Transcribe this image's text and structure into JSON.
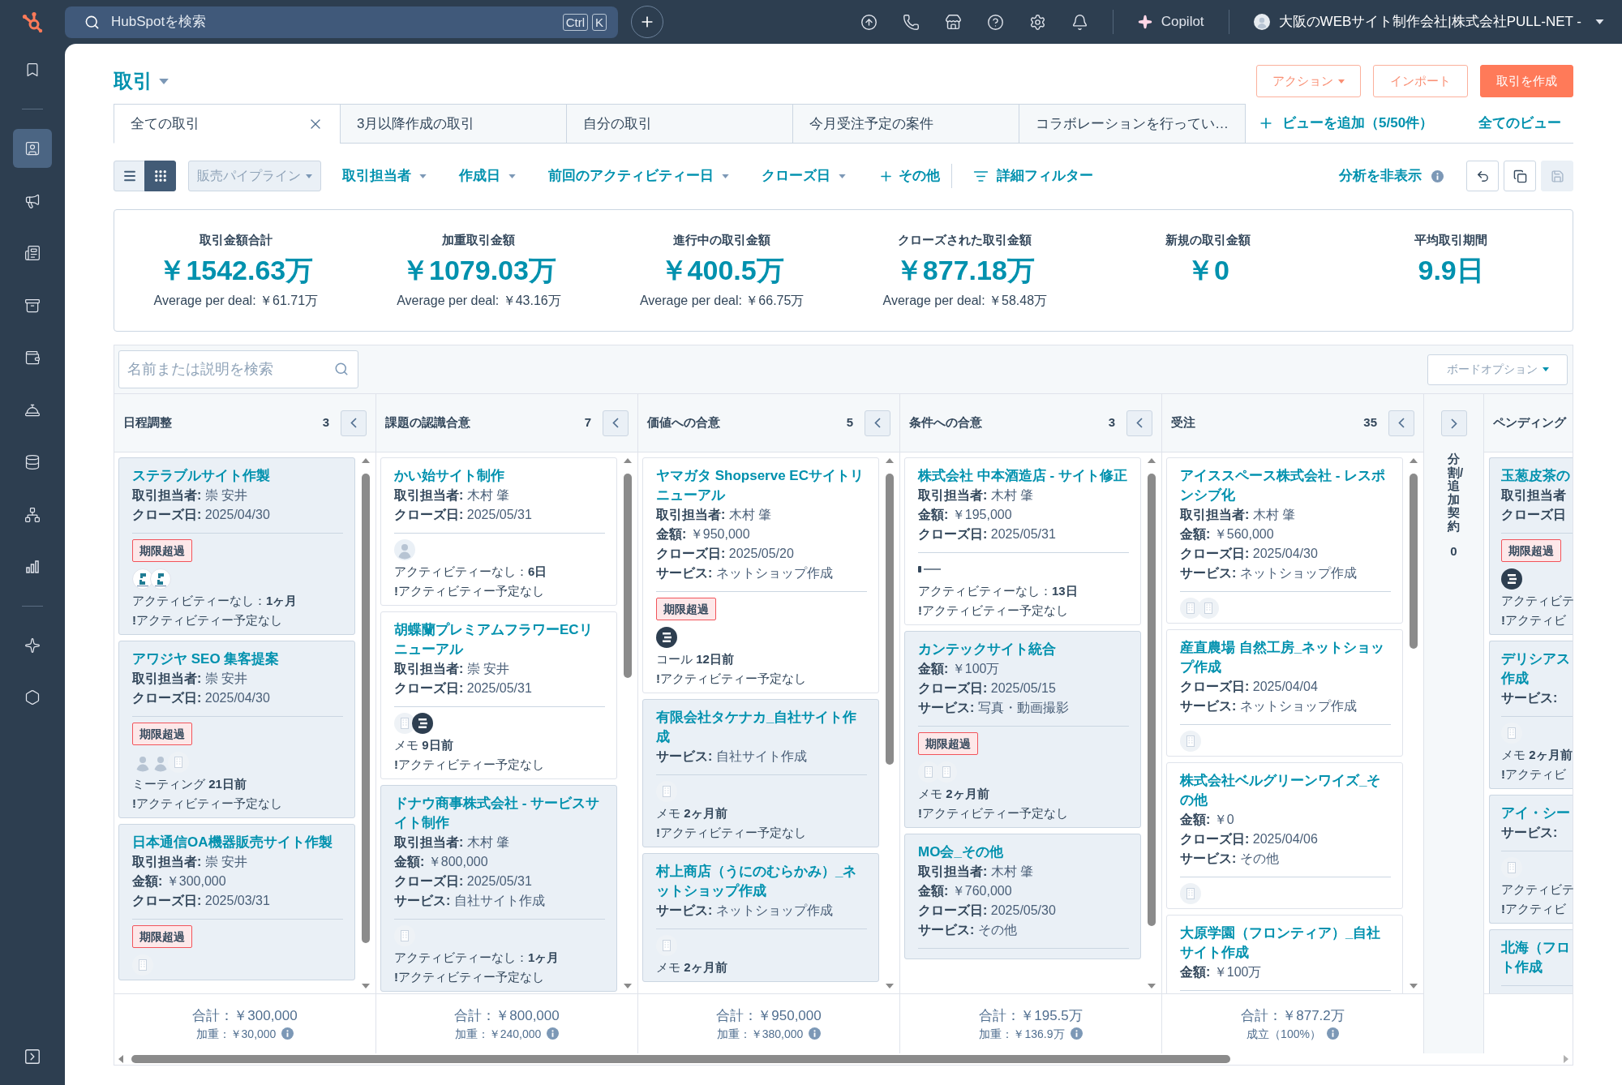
{
  "top_bar": {
    "search": {
      "placeholder": "HubSpotを検索"
    },
    "shortcut_keys": [
      "Ctrl",
      "K"
    ],
    "copilot": "Copilot",
    "account": "大阪のWEBサイト制作会社|株式会社PULL-NET -"
  },
  "sidebar": {
    "items": [
      {
        "selected": false
      },
      {
        "selected": true
      },
      {
        "selected": false
      },
      {
        "selected": false
      },
      {
        "selected": false
      },
      {
        "selected": false
      },
      {
        "selected": false
      },
      {
        "selected": false
      },
      {
        "selected": false
      },
      {
        "selected": false
      },
      {
        "selected": false
      },
      {
        "selected": false
      }
    ]
  },
  "header": {
    "title": "取引",
    "buttons": [
      {
        "label": "アクション",
        "kind": "menu"
      },
      {
        "label": "インポート",
        "kind": "outline"
      },
      {
        "label": "取引を作成",
        "kind": "primary"
      }
    ]
  },
  "view_tabs": {
    "tabs": [
      {
        "label": "全ての取引",
        "selected": true
      },
      {
        "label": "3月以降作成の取引",
        "selected": false
      },
      {
        "label": "自分の取引",
        "selected": false
      },
      {
        "label": "今月受注予定の案件",
        "selected": false
      },
      {
        "label": "コラボレーションを行ってい…",
        "selected": false
      }
    ],
    "add_view": "ビューを追加（5/50件）",
    "all_views": "全てのビュー"
  },
  "filter_bar": {
    "view_modes": [
      {
        "selected": false
      },
      {
        "selected": true
      }
    ],
    "pipeline": "販売パイプライン",
    "filters": [
      {
        "label": "取引担当者",
        "kind": "dropdown"
      },
      {
        "label": "作成日",
        "kind": "dropdown"
      },
      {
        "label": "前回のアクティビティー日",
        "kind": "dropdown"
      },
      {
        "label": "クローズ日",
        "kind": "dropdown"
      },
      {
        "label": "その他",
        "kind": "add"
      }
    ],
    "advanced_filters": "詳細フィルター",
    "analytics_toggle": "分析を非表示",
    "tools": [
      {
        "disabled": false
      },
      {
        "disabled": false
      },
      {
        "disabled": true
      }
    ]
  },
  "metrics": [
    {
      "label": "取引金額合計",
      "value": "￥1542.63万",
      "average": "Average per deal: ￥61.71万"
    },
    {
      "label": "加重取引金額",
      "value": "￥1079.03万",
      "average": "Average per deal: ￥43.16万"
    },
    {
      "label": "進行中の取引金額",
      "value": "￥400.5万",
      "average": "Average per deal: ￥66.75万"
    },
    {
      "label": "クローズされた取引金額",
      "value": "￥877.18万",
      "average": "Average per deal: ￥58.48万"
    },
    {
      "label": "新規の取引金額",
      "value": "￥0"
    },
    {
      "label": "平均取引期間",
      "value": "9.9日"
    }
  ],
  "board": {
    "search": {
      "placeholder": "名前または説明を検索"
    },
    "options": "ボードオプション",
    "columns": [
      {
        "name": "日程調整",
        "count": "3",
        "collapsed": false,
        "cards": [
          {
            "title": "ステラブルサイト作製",
            "shaded": true,
            "fields": [
              {
                "label": "取引担当者:",
                "value": "崇 安井"
              },
              {
                "label": "クローズ日:",
                "value": "2025/04/30"
              }
            ],
            "badge": "期限超過",
            "avatars": [
              {
                "kind": "monogram"
              },
              {
                "kind": "monogram"
              }
            ],
            "activity": "アクティビティーなし：**1ヶ月**",
            "next": "**!**アクティビティー予定なし"
          },
          {
            "title": "アワジヤ SEO 集客提案",
            "shaded": true,
            "fields": [
              {
                "label": "取引担当者:",
                "value": "崇 安井"
              },
              {
                "label": "クローズ日:",
                "value": "2025/04/30"
              }
            ],
            "badge": "期限超過",
            "avatars": [
              {
                "kind": "contact"
              },
              {
                "kind": "contact"
              },
              {
                "kind": "company"
              }
            ],
            "activity": "ミーティング **21日前**",
            "next": "**!**アクティビティー予定なし"
          },
          {
            "title": "日本通信OA機器販売サイト作製",
            "shaded": true,
            "fields": [
              {
                "label": "取引担当者:",
                "value": "崇 安井"
              },
              {
                "label": "金額:",
                "value": "￥300,000"
              },
              {
                "label": "クローズ日:",
                "value": "2025/03/31"
              }
            ],
            "badge": "期限超過",
            "avatars": [
              {
                "kind": "company"
              }
            ]
          }
        ],
        "total": "合計：￥300,000",
        "subtotal": "加重：￥30,000"
      },
      {
        "name": "課題の認識合意",
        "count": "7",
        "collapsed": false,
        "cards": [
          {
            "title": "かい始サイト制作",
            "shaded": false,
            "fields": [
              {
                "label": "取引担当者:",
                "value": "木村 肇"
              },
              {
                "label": "クローズ日:",
                "value": "2025/05/31"
              }
            ],
            "avatars": [
              {
                "kind": "contact"
              }
            ],
            "activity": "アクティビティーなし：**6日**",
            "next": "**!**アクティビティー予定なし"
          },
          {
            "title": "胡蝶蘭プレミアムフラワーECリニューアル",
            "shaded": false,
            "fields": [
              {
                "label": "取引担当者:",
                "value": "崇 安井"
              },
              {
                "label": "クローズ日:",
                "value": "2025/05/31"
              }
            ],
            "avatars": [
              {
                "kind": "company"
              },
              {
                "kind": "emblem"
              }
            ],
            "activity": "メモ **9日前**",
            "next": "**!**アクティビティー予定なし"
          },
          {
            "title": "ドナウ商事株式会社 - サービスサイト制作",
            "shaded": true,
            "fields": [
              {
                "label": "取引担当者:",
                "value": "木村 肇"
              },
              {
                "label": "金額:",
                "value": "￥800,000"
              },
              {
                "label": "クローズ日:",
                "value": "2025/05/31"
              },
              {
                "label": "サービス:",
                "value": "自社サイト作成"
              }
            ],
            "avatars": [
              {
                "kind": "company"
              }
            ],
            "activity": "アクティビティーなし：**1ヶ月**",
            "next": "**!**アクティビティー予定なし"
          }
        ],
        "total": "合計：￥800,000",
        "subtotal": "加重：￥240,000"
      },
      {
        "name": "価値への合意",
        "count": "5",
        "collapsed": false,
        "cards": [
          {
            "title": "ヤマガタ Shopserve ECサイトリニューアル",
            "shaded": false,
            "fields": [
              {
                "label": "取引担当者:",
                "value": "木村 肇"
              },
              {
                "label": "金額:",
                "value": "￥950,000"
              },
              {
                "label": "クローズ日:",
                "value": "2025/05/20"
              },
              {
                "label": "サービス:",
                "value": "ネットショップ作成"
              }
            ],
            "badge": "期限超過",
            "avatars": [
              {
                "kind": "emblem"
              }
            ],
            "activity": "コール **12日前**",
            "next": "**!**アクティビティー予定なし"
          },
          {
            "title": "有限会社タケナカ_自社サイト作成",
            "shaded": true,
            "fields": [
              {
                "label": "サービス:",
                "value": "自社サイト作成"
              }
            ],
            "avatars": [
              {
                "kind": "company"
              }
            ],
            "activity": "メモ **2ヶ月前**",
            "next": "**!**アクティビティー予定なし"
          },
          {
            "title": "村上商店（うにのむらかみ）_ネットショップ作成",
            "shaded": true,
            "fields": [
              {
                "label": "サービス:",
                "value": "ネットショップ作成"
              }
            ],
            "avatars": [
              {
                "kind": "company"
              }
            ],
            "activity": "メモ **2ヶ月前**"
          }
        ],
        "total": "合計：￥950,000",
        "subtotal": "加重：￥380,000"
      },
      {
        "name": "条件への合意",
        "count": "3",
        "collapsed": false,
        "cards": [
          {
            "title": "株式会社 中本酒造店 - サイト修正",
            "shaded": false,
            "fields": [
              {
                "label": "取引担当者:",
                "value": "木村 肇"
              },
              {
                "label": "金額:",
                "value": "￥195,000"
              },
              {
                "label": "クローズ日:",
                "value": "2025/05/31"
              }
            ],
            "avatars": [
              {
                "kind": "wordmark"
              }
            ],
            "activity": "アクティビティーなし：**13日**",
            "next": "**!**アクティビティー予定なし"
          },
          {
            "title": "カンテックサイト統合",
            "shaded": true,
            "fields": [
              {
                "label": "金額:",
                "value": "￥100万"
              },
              {
                "label": "クローズ日:",
                "value": "2025/05/15"
              },
              {
                "label": "サービス:",
                "value": "写真・動画撮影"
              }
            ],
            "badge": "期限超過",
            "avatars": [
              {
                "kind": "company"
              },
              {
                "kind": "company"
              }
            ],
            "activity": "メモ **2ヶ月前**",
            "next": "**!**アクティビティー予定なし"
          },
          {
            "title": "MO会_その他",
            "shaded": true,
            "fields": [
              {
                "label": "取引担当者:",
                "value": "木村 肇"
              },
              {
                "label": "金額:",
                "value": "￥760,000"
              },
              {
                "label": "クローズ日:",
                "value": "2025/05/30"
              },
              {
                "label": "サービス:",
                "value": "その他"
              }
            ]
          }
        ],
        "total": "合計：￥195.5万",
        "subtotal": "加重：￥136.9万"
      },
      {
        "name": "受注",
        "count": "35",
        "collapsed": false,
        "cards": [
          {
            "title": "アイススペース株式会社 - レスポンシブ化",
            "shaded": false,
            "fields": [
              {
                "label": "取引担当者:",
                "value": "木村 肇"
              },
              {
                "label": "金額:",
                "value": "￥560,000"
              },
              {
                "label": "クローズ日:",
                "value": "2025/04/30"
              },
              {
                "label": "サービス:",
                "value": "ネットショップ作成"
              }
            ],
            "avatars": [
              {
                "kind": "company"
              },
              {
                "kind": "company"
              }
            ]
          },
          {
            "title": "産直農場 自然工房_ネットショップ作成",
            "shaded": false,
            "fields": [
              {
                "label": "クローズ日:",
                "value": "2025/04/04"
              },
              {
                "label": "サービス:",
                "value": "ネットショップ作成"
              }
            ],
            "avatars": [
              {
                "kind": "company"
              }
            ]
          },
          {
            "title": "株式会社ベルグリーンワイズ_その他",
            "shaded": false,
            "fields": [
              {
                "label": "金額:",
                "value": "￥0"
              },
              {
                "label": "クローズ日:",
                "value": "2025/04/06"
              },
              {
                "label": "サービス:",
                "value": "その他"
              }
            ],
            "avatars": [
              {
                "kind": "company"
              }
            ]
          },
          {
            "title": "大原学園（フロンティア）_自社サイト作成",
            "shaded": false,
            "fields": [
              {
                "label": "金額:",
                "value": "￥100万"
              }
            ]
          }
        ],
        "total": "合計：￥877.2万",
        "subtotal": "成立（100%）"
      },
      {
        "name": "分割/追加契約",
        "count": "0",
        "collapsed": true
      },
      {
        "name": "ペンディング",
        "collapsed": false,
        "cards": [
          {
            "title": "玉葱皮茶の",
            "shaded": true,
            "fields": [
              {
                "label": "取引担当者"
              },
              {
                "label": "クローズ日"
              }
            ],
            "badge": "期限超過",
            "avatars": [
              {
                "kind": "emblem"
              }
            ],
            "activity": "アクティビテ",
            "next": "**!**アクティビ"
          },
          {
            "title_lines": [
              "デリシアス",
              "作成"
            ],
            "shaded": true,
            "fields": [
              {
                "label": "サービス:"
              }
            ],
            "avatars": [
              {
                "kind": "company"
              }
            ],
            "activity": "メモ **2ヶ月前**",
            "next": "**!**アクティビ"
          },
          {
            "title": "アイ・シー",
            "shaded": true,
            "fields": [
              {
                "label": "サービス:"
              }
            ],
            "avatars": [
              {
                "kind": "company"
              }
            ],
            "activity": "アクティビテ",
            "next": "**!**アクティビ"
          },
          {
            "title_lines": [
              "北海（フロ",
              "ト作成"
            ],
            "shaded": true
          }
        ]
      }
    ]
  }
}
